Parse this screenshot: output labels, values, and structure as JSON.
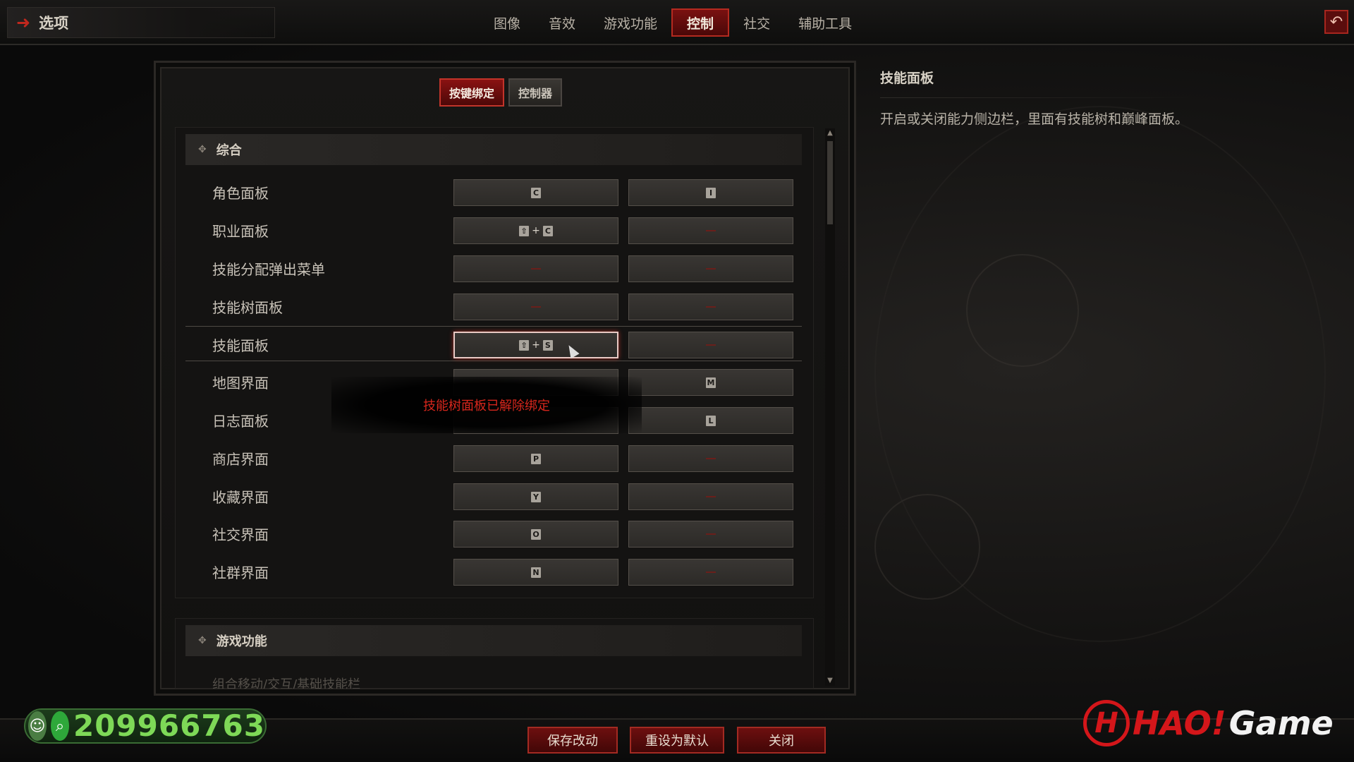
{
  "header": {
    "title": "选项",
    "tabs": [
      "图像",
      "音效",
      "游戏功能",
      "控制",
      "社交",
      "辅助工具"
    ],
    "active_tab": "控制",
    "back_icon": "undo-arrow-icon"
  },
  "subtabs": {
    "items": [
      "按键绑定",
      "控制器"
    ],
    "active": "按键绑定"
  },
  "sections": {
    "general": "综合",
    "gameplay": "游戏功能",
    "gameplay_first_row": "组合移动/交互/基础技能栏"
  },
  "bindings": [
    {
      "label": "角色面板",
      "primary": [
        "C"
      ],
      "secondary": [
        "I"
      ]
    },
    {
      "label": "职业面板",
      "primary": [
        "⇧",
        "C"
      ],
      "secondary": []
    },
    {
      "label": "技能分配弹出菜单",
      "primary": [],
      "secondary": []
    },
    {
      "label": "技能树面板",
      "primary": [],
      "secondary": []
    },
    {
      "label": "技能面板",
      "primary": [
        "⇧",
        "S"
      ],
      "secondary": [],
      "selected": true
    },
    {
      "label": "地图界面",
      "primary": [],
      "secondary": [
        "M"
      ]
    },
    {
      "label": "日志面板",
      "primary": [],
      "secondary": [
        "L"
      ]
    },
    {
      "label": "商店界面",
      "primary": [
        "P"
      ],
      "secondary": []
    },
    {
      "label": "收藏界面",
      "primary": [
        "Y"
      ],
      "secondary": []
    },
    {
      "label": "社交界面",
      "primary": [
        "O"
      ],
      "secondary": []
    },
    {
      "label": "社群界面",
      "primary": [
        "N"
      ],
      "secondary": []
    }
  ],
  "toast": "技能树面板已解除绑定",
  "description": {
    "title": "技能面板",
    "text": "开启或关闭能力侧边栏，里面有技能树和巅峰面板。"
  },
  "footer": {
    "save": "保存改动",
    "reset": "重设为默认",
    "close": "关闭"
  },
  "watermark": {
    "qq_number": "209966763",
    "brand_hao": "HAO!",
    "brand_game": "Game"
  },
  "colors": {
    "accent_red": "#a32a22",
    "qq_green": "#7ed957",
    "brand_red": "#d4161a"
  }
}
